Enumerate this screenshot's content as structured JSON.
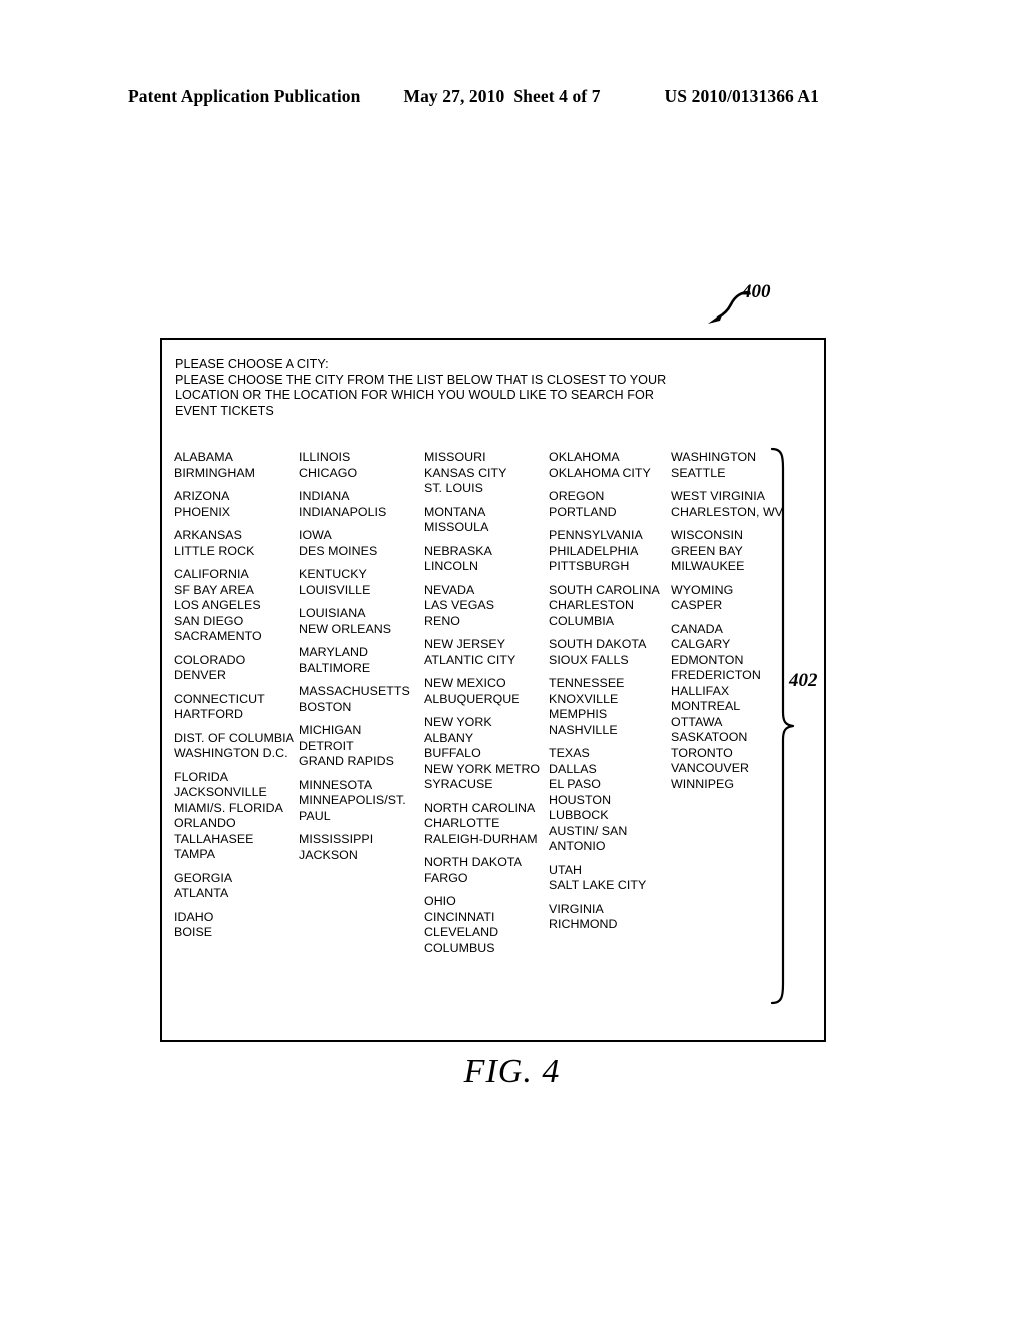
{
  "page_header": {
    "title": "Patent Application Publication",
    "date": "May 27, 2010",
    "sheet": "Sheet 4 of 7",
    "publication_number": "US 2010/0131366 A1"
  },
  "figure": {
    "caption": "FIG. 4",
    "ref_screen": "400",
    "ref_list": "402"
  },
  "prompt": {
    "line1": "PLEASE CHOOSE A CITY:",
    "line2": "PLEASE CHOOSE THE CITY FROM THE LIST BELOW THAT IS CLOSEST TO YOUR",
    "line3": "LOCATION OR THE LOCATION FOR WHICH YOU WOULD LIKE TO SEARCH FOR",
    "line4": "EVENT TICKETS"
  },
  "city_columns": [
    {
      "groups": [
        {
          "state": "ALABAMA",
          "cities": [
            "BIRMINGHAM"
          ]
        },
        {
          "state": "ARIZONA",
          "cities": [
            "PHOENIX"
          ]
        },
        {
          "state": "ARKANSAS",
          "cities": [
            "LITTLE ROCK"
          ]
        },
        {
          "state": "CALIFORNIA",
          "cities": [
            "SF BAY AREA",
            "LOS ANGELES",
            "SAN DIEGO",
            "SACRAMENTO"
          ]
        },
        {
          "state": "COLORADO",
          "cities": [
            "DENVER"
          ]
        },
        {
          "state": "CONNECTICUT",
          "cities": [
            "HARTFORD"
          ]
        },
        {
          "state": "DIST. OF COLUMBIA",
          "cities": [
            "WASHINGTON D.C."
          ]
        },
        {
          "state": "FLORIDA",
          "cities": [
            "JACKSONVILLE",
            "MIAMI/S. FLORIDA",
            "ORLANDO",
            "TALLAHASEE",
            "TAMPA"
          ]
        },
        {
          "state": "GEORGIA",
          "cities": [
            "ATLANTA"
          ]
        },
        {
          "state": "IDAHO",
          "cities": [
            "BOISE"
          ]
        }
      ]
    },
    {
      "groups": [
        {
          "state": "ILLINOIS",
          "cities": [
            "CHICAGO"
          ]
        },
        {
          "state": "INDIANA",
          "cities": [
            "INDIANAPOLIS"
          ]
        },
        {
          "state": "IOWA",
          "cities": [
            "DES MOINES"
          ]
        },
        {
          "state": "KENTUCKY",
          "cities": [
            "LOUISVILLE"
          ]
        },
        {
          "state": "LOUISIANA",
          "cities": [
            "NEW ORLEANS"
          ]
        },
        {
          "state": "MARYLAND",
          "cities": [
            "BALTIMORE"
          ]
        },
        {
          "state": "MASSACHUSETTS",
          "cities": [
            "BOSTON"
          ]
        },
        {
          "state": "MICHIGAN",
          "cities": [
            "DETROIT",
            "GRAND RAPIDS"
          ]
        },
        {
          "state": "MINNESOTA",
          "cities": [
            "MINNEAPOLIS/ST.",
            "PAUL"
          ]
        },
        {
          "state": "MISSISSIPPI",
          "cities": [
            "JACKSON"
          ]
        }
      ]
    },
    {
      "groups": [
        {
          "state": "MISSOURI",
          "cities": [
            "KANSAS CITY",
            "ST. LOUIS"
          ]
        },
        {
          "state": "MONTANA",
          "cities": [
            "MISSOULA"
          ]
        },
        {
          "state": "NEBRASKA",
          "cities": [
            "LINCOLN"
          ]
        },
        {
          "state": "NEVADA",
          "cities": [
            "LAS VEGAS",
            "RENO"
          ]
        },
        {
          "state": "NEW JERSEY",
          "cities": [
            "ATLANTIC CITY"
          ]
        },
        {
          "state": "NEW MEXICO",
          "cities": [
            "ALBUQUERQUE"
          ]
        },
        {
          "state": "NEW YORK",
          "cities": [
            "ALBANY",
            "BUFFALO",
            "NEW YORK METRO",
            "SYRACUSE"
          ]
        },
        {
          "state": "NORTH CAROLINA",
          "cities": [
            "CHARLOTTE",
            "RALEIGH-DURHAM"
          ]
        },
        {
          "state": "NORTH DAKOTA",
          "cities": [
            "FARGO"
          ]
        },
        {
          "state": "OHIO",
          "cities": [
            "CINCINNATI",
            "CLEVELAND",
            "COLUMBUS"
          ]
        }
      ]
    },
    {
      "groups": [
        {
          "state": "OKLAHOMA",
          "cities": [
            "OKLAHOMA CITY"
          ]
        },
        {
          "state": "OREGON",
          "cities": [
            "PORTLAND"
          ]
        },
        {
          "state": "PENNSYLVANIA",
          "cities": [
            "PHILADELPHIA",
            "PITTSBURGH"
          ]
        },
        {
          "state": "SOUTH CAROLINA",
          "cities": [
            "CHARLESTON",
            "COLUMBIA"
          ]
        },
        {
          "state": "SOUTH DAKOTA",
          "cities": [
            "SIOUX FALLS"
          ]
        },
        {
          "state": "TENNESSEE",
          "cities": [
            "KNOXVILLE",
            "MEMPHIS",
            "NASHVILLE"
          ]
        },
        {
          "state": "TEXAS",
          "cities": [
            "DALLAS",
            "EL PASO",
            "HOUSTON",
            "LUBBOCK",
            "AUSTIN/ SAN",
            "ANTONIO"
          ]
        },
        {
          "state": "UTAH",
          "cities": [
            "SALT LAKE CITY"
          ]
        },
        {
          "state": "VIRGINIA",
          "cities": [
            "RICHMOND"
          ]
        }
      ]
    },
    {
      "groups": [
        {
          "state": "WASHINGTON",
          "cities": [
            "SEATTLE"
          ]
        },
        {
          "state": "WEST VIRGINIA",
          "cities": [
            "CHARLESTON, WV"
          ]
        },
        {
          "state": "WISCONSIN",
          "cities": [
            "GREEN BAY",
            "MILWAUKEE"
          ]
        },
        {
          "state": "WYOMING",
          "cities": [
            "CASPER"
          ]
        },
        {
          "state": "CANADA",
          "cities": [
            "CALGARY",
            "EDMONTON",
            "FREDERICTON",
            "HALLIFAX",
            "MONTREAL",
            "OTTAWA",
            "SASKATOON",
            "TORONTO",
            "VANCOUVER",
            "WINNIPEG"
          ]
        }
      ]
    }
  ]
}
